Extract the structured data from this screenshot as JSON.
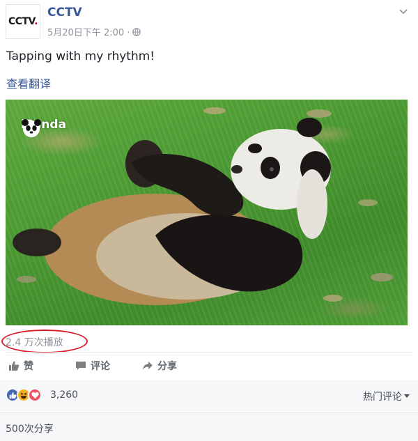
{
  "post": {
    "avatar_text": "CCTV",
    "avatar_dot": ".",
    "page_name": "CCTV",
    "timestamp": "5月20日下午 2:00 ·",
    "text": "Tapping with my rhythm!",
    "translate_label": "查看翻译"
  },
  "video": {
    "watermark": "iPanda"
  },
  "stats": {
    "views": "2.4 万次播放",
    "reaction_count": "3,260",
    "sort_label": "热门评论",
    "shares": "500次分享"
  },
  "actions": {
    "like_label": "赞",
    "comment_label": "评论",
    "share_label": "分享"
  },
  "colors": {
    "link": "#365899",
    "like_blue": "#4267b2",
    "haha_yellow": "#f7b125",
    "love_red": "#f25268",
    "highlight_circle": "#d9202a"
  }
}
